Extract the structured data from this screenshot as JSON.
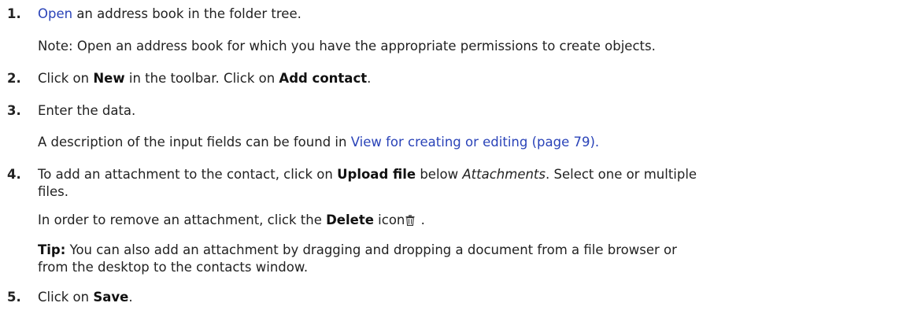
{
  "steps": [
    {
      "num": "1.",
      "link": "Open",
      "text": " an address book in the folder tree.",
      "note": "Note:  Open an address book for which you have the appropriate permissions to create objects."
    },
    {
      "num": "2.",
      "t1": "Click on ",
      "b1": "New",
      "t2": " in the toolbar. Click on ",
      "b2": "Add contact",
      "t3": "."
    },
    {
      "num": "3.",
      "text": "Enter the data.",
      "desc_prefix": "A description of the input fields can be found in ",
      "desc_link": "View for creating or editing (page 79)."
    },
    {
      "num": "4.",
      "l1_t1": "To add an attachment to the contact, click on ",
      "l1_b": "Upload file",
      "l1_t2": " below ",
      "l1_i": "Attachments",
      "l1_t3": ". Select one or multiple",
      "l2": "files.",
      "remove_t1": "In order to remove an attachment, click the ",
      "remove_b": "Delete",
      "remove_t2": " icon",
      "remove_t3": " .",
      "tip_label": "Tip:",
      "tip_l1": " You can also add an attachment by dragging and dropping a document from a file browser or",
      "tip_l2": "from the desktop to the contacts window.",
      "icon": "trash-icon"
    },
    {
      "num": "5.",
      "t1": "Click on ",
      "b1": "Save",
      "t2": "."
    }
  ]
}
